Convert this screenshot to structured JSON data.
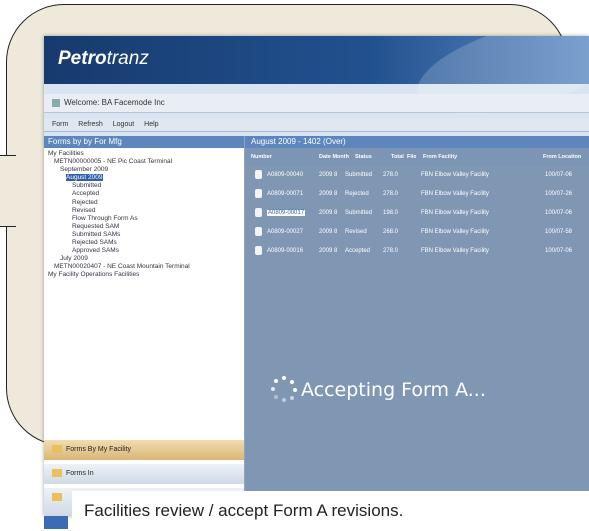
{
  "app": {
    "logo_main": "Petro",
    "logo_sub": "tranz"
  },
  "welcome": {
    "text": "Welcome: BA Facemode Inc"
  },
  "menu": [
    "Form",
    "Refresh",
    "Logout",
    "Help"
  ],
  "left_panel": {
    "title": "Forms by by For Mfg",
    "tree": [
      "My Facilities",
      "METN00000005 - NE Pic Coast Terminal",
      "September 2009",
      "August 2009",
      "Submitted",
      "Accepted",
      "Rejected",
      "Revised",
      "Flow Through Form As",
      "Requested SAM",
      "Submitted SAMs",
      "Rejected SAMs",
      "Approved SAMs",
      "July 2009",
      "METN00020407 - NE Coast Mountain Terminal",
      "My Facility Operations Facilities"
    ],
    "selected_index": 3,
    "nav": [
      "Forms By My Facility",
      "Forms In",
      ""
    ]
  },
  "right_panel": {
    "title": "August 2009 - 1402 (Over)",
    "columns": [
      "Number",
      "Date Month",
      "Status",
      "Total",
      "File",
      "From Facility",
      "From Location"
    ],
    "rows": [
      {
        "number": "A0809-00040",
        "date": "2009 8",
        "status": "Submitted",
        "total": "278.0",
        "facility": "FBN Elbow Valley Facility",
        "location": "100/07-06"
      },
      {
        "number": "A0809-00071",
        "date": "2009 8",
        "status": "Rejected",
        "total": "278.0",
        "facility": "FBN Elbow Valley Facility",
        "location": "100/07-26"
      },
      {
        "number": "A0809-00017",
        "date": "2009 8",
        "status": "Submitted",
        "total": "198.0",
        "facility": "FBN Elbow Valley Facility",
        "location": "100/07-06"
      },
      {
        "number": "A0809-00027",
        "date": "2009 8",
        "status": "Revised",
        "total": "268.0",
        "facility": "FBN Elbow Valley Facility",
        "location": "100/07-58"
      },
      {
        "number": "A0809-00016",
        "date": "2009 8",
        "status": "Accepted",
        "total": "278.0",
        "facility": "FBN Elbow Valley Facility",
        "location": "100/07-06"
      }
    ],
    "highlight_row": 2,
    "loading_text": "Accepting Form A..."
  },
  "caption": "Facilities review / accept Form A revisions.",
  "colors": {
    "header_blue": "#22518f",
    "panel_blue": "#5d86bd",
    "grid_bg": "#7f97b3",
    "bubble": "#efe9dc"
  }
}
